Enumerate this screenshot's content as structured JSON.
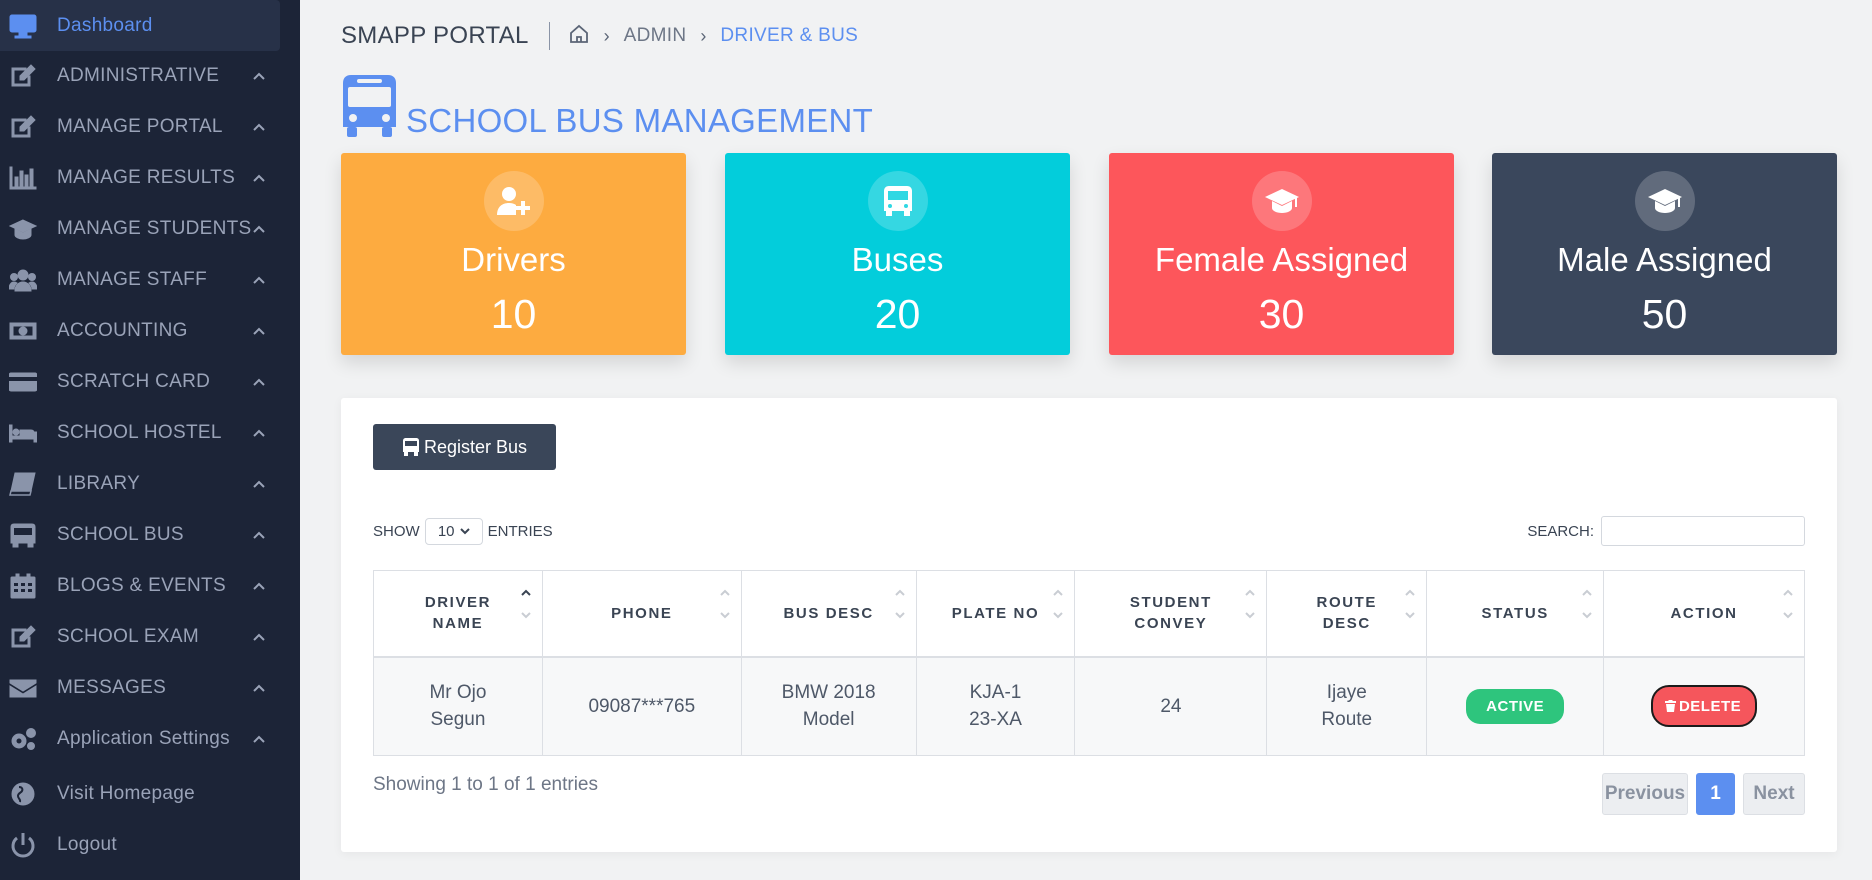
{
  "sidebar": {
    "items": [
      {
        "label": "Dashboard",
        "icon": "monitor-icon"
      },
      {
        "label": "ADMINISTRATIVE",
        "icon": "edit-icon"
      },
      {
        "label": "MANAGE PORTAL",
        "icon": "edit-icon"
      },
      {
        "label": "MANAGE RESULTS",
        "icon": "bar-chart-icon"
      },
      {
        "label": "MANAGE STUDENTS",
        "icon": "graduation-cap-icon"
      },
      {
        "label": "MANAGE STAFF",
        "icon": "users-icon"
      },
      {
        "label": "ACCOUNTING",
        "icon": "money-icon"
      },
      {
        "label": "SCRATCH CARD",
        "icon": "credit-card-icon"
      },
      {
        "label": "SCHOOL HOSTEL",
        "icon": "bed-icon"
      },
      {
        "label": "LIBRARY",
        "icon": "book-icon"
      },
      {
        "label": "SCHOOL BUS",
        "icon": "bus-icon"
      },
      {
        "label": "BLOGS & EVENTS",
        "icon": "calendar-icon"
      },
      {
        "label": "SCHOOL EXAM",
        "icon": "edit-icon"
      },
      {
        "label": "MESSAGES",
        "icon": "envelope-icon"
      },
      {
        "label": "Application Settings",
        "icon": "cogs-icon"
      },
      {
        "label": "Visit Homepage",
        "icon": "globe-icon"
      },
      {
        "label": "Logout",
        "icon": "power-icon"
      }
    ]
  },
  "header": {
    "brand": "SMAPP PORTAL",
    "breadcrumb": [
      "ADMIN",
      "DRIVER & BUS"
    ]
  },
  "page": {
    "title": "SCHOOL BUS MANAGEMENT"
  },
  "stats": [
    {
      "label": "Drivers",
      "value": "10",
      "color": "#fdab40",
      "icon": "user-plus-icon"
    },
    {
      "label": "Buses",
      "value": "20",
      "color": "#03cddb",
      "icon": "bus-icon"
    },
    {
      "label": "Female Assigned",
      "value": "30",
      "color": "#fd565b",
      "icon": "graduation-cap-icon"
    },
    {
      "label": "Male Assigned",
      "value": "50",
      "color": "#3a475c",
      "icon": "graduation-cap-icon"
    }
  ],
  "panel": {
    "register_label": "Register Bus",
    "show_label": "SHOW",
    "entries_label": "ENTRIES",
    "page_length": "10",
    "search_label": "SEARCH:",
    "search_value": "",
    "columns": [
      "DRIVER NAME",
      "PHONE",
      "BUS DESC",
      "PLATE NO",
      "STUDENT CONVEY",
      "ROUTE DESC",
      "STATUS",
      "ACTION"
    ],
    "rows": [
      {
        "driver_name": "Mr Ojo Segun",
        "phone": "09087***765",
        "bus_desc": "BMW 2018 Model",
        "plate_no": "KJA-123-XA",
        "student_convey": "24",
        "route_desc": "Ijaye Route",
        "status": "ACTIVE",
        "action": "DELETE"
      }
    ],
    "info": "Showing 1 to 1 of 1 entries",
    "pagination": {
      "previous": "Previous",
      "current": "1",
      "next": "Next"
    }
  }
}
